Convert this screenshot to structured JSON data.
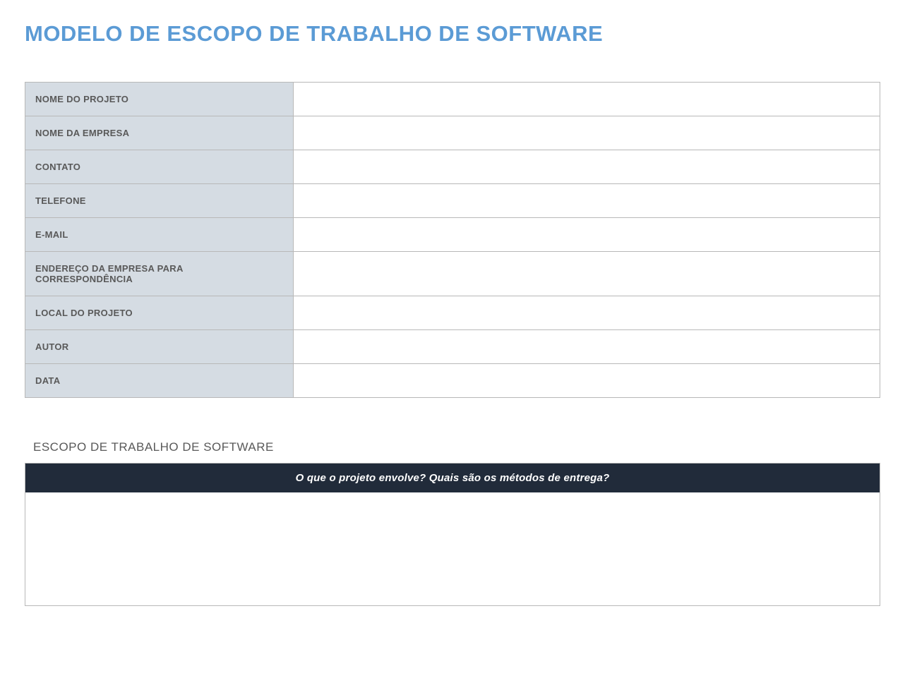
{
  "title": "MODELO DE ESCOPO DE TRABALHO DE SOFTWARE",
  "info_rows": [
    {
      "label": "NOME DO PROJETO",
      "value": ""
    },
    {
      "label": "NOME DA EMPRESA",
      "value": ""
    },
    {
      "label": "CONTATO",
      "value": ""
    },
    {
      "label": "TELEFONE",
      "value": ""
    },
    {
      "label": "E-MAIL",
      "value": ""
    },
    {
      "label": "ENDEREÇO DA EMPRESA PARA CORRESPONDÊNCIA",
      "value": ""
    },
    {
      "label": "LOCAL DO PROJETO",
      "value": ""
    },
    {
      "label": "AUTOR",
      "value": ""
    },
    {
      "label": "DATA",
      "value": ""
    }
  ],
  "scope_section": {
    "heading": "ESCOPO DE TRABALHO DE SOFTWARE",
    "prompt": "O que o projeto envolve? Quais são os métodos de entrega?",
    "content": ""
  }
}
